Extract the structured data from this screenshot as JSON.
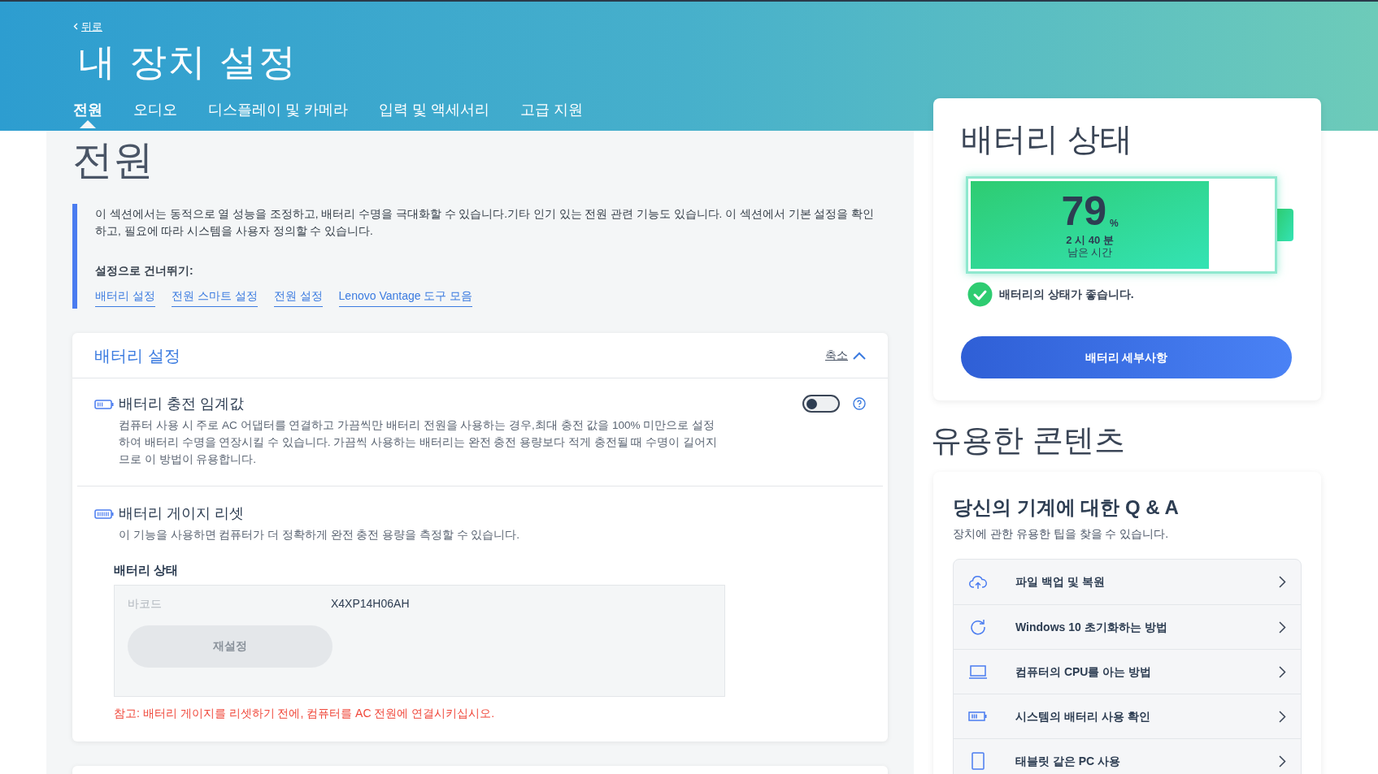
{
  "header": {
    "back_link": "뒤로",
    "title": "내 장치 설정"
  },
  "tabs": [
    {
      "label": "전원",
      "selected": true
    },
    {
      "label": "오디오",
      "selected": false
    },
    {
      "label": "디스플레이 및 카메라",
      "selected": false
    },
    {
      "label": "입력 및 액세서리",
      "selected": false
    },
    {
      "label": "고급 지원",
      "selected": false
    }
  ],
  "section": {
    "title": "전원",
    "description": "이 섹션에서는 동적으로 열 성능을 조정하고, 배터리 수명을 극대화할 수 있습니다.기타 인기 있는 전원 관련 기능도 있습니다. 이 섹션에서 기본 설정을 확인하고, 필요에 따라 시스템을 사용자 정의할 수 있습니다.",
    "jump_label": "설정으로 건너뛰기:",
    "jump_links": [
      "배터리 설정",
      "전원 스마트 설정",
      "전원 설정",
      "Lenovo Vantage 도구 모음"
    ]
  },
  "battery_settings": {
    "title": "배터리 설정",
    "collapse_label": "축소",
    "expanded": true,
    "items": [
      {
        "kind": "toggle",
        "title": "배터리 충전 임계값",
        "description": "컴퓨터 사용 시 주로 AC 어댑터를 연결하고 가끔씩만 배터리 전원을 사용하는 경우,최대 충전 값을 100% 미만으로 설정하여 배터리 수명을 연장시킬 수 있습니다. 가끔씩 사용하는 배터리는 완전 충전 용량보다 적게 충전될 때 수명이 길어지므로 이 방법이 유용합니다.",
        "on": false
      },
      {
        "kind": "reset",
        "title": "배터리 게이지 리셋",
        "description": "이 기능을 사용하면 컴퓨터가 더 정확하게 완전 충전 용량을 측정할 수 있습니다.",
        "status_label": "배터리 상태",
        "field_label": "바코드",
        "field_value": "X4XP14H06AH",
        "button": "재설정",
        "disabled": true,
        "note": "참고: 배터리 게이지를 리셋하기 전에, 컴퓨터를 AC 전원에 연결시키십시오."
      }
    ]
  },
  "battery_status": {
    "title": "배터리 상태",
    "level": 0.79,
    "percent": "79",
    "unit": "%",
    "time_left": "2 시 40 분",
    "time_label": "남은 시간",
    "health": "배터리의 상태가 좋습니다.",
    "button": "배터리 세부사항"
  },
  "useful_content": {
    "title": "유용한 콘텐츠",
    "card_title": "당신의 기계에 대한 Q & A",
    "card_subtitle": "장치에 관한 유용한 팁을 찾을 수 있습니다.",
    "items": [
      "파일 백업 및 복원",
      "Windows 10 초기화하는 방법",
      "컴퓨터의 CPU를 아는 방법",
      "시스템의 배터리 사용 확인",
      "태블릿 같은 PC 사용"
    ]
  }
}
